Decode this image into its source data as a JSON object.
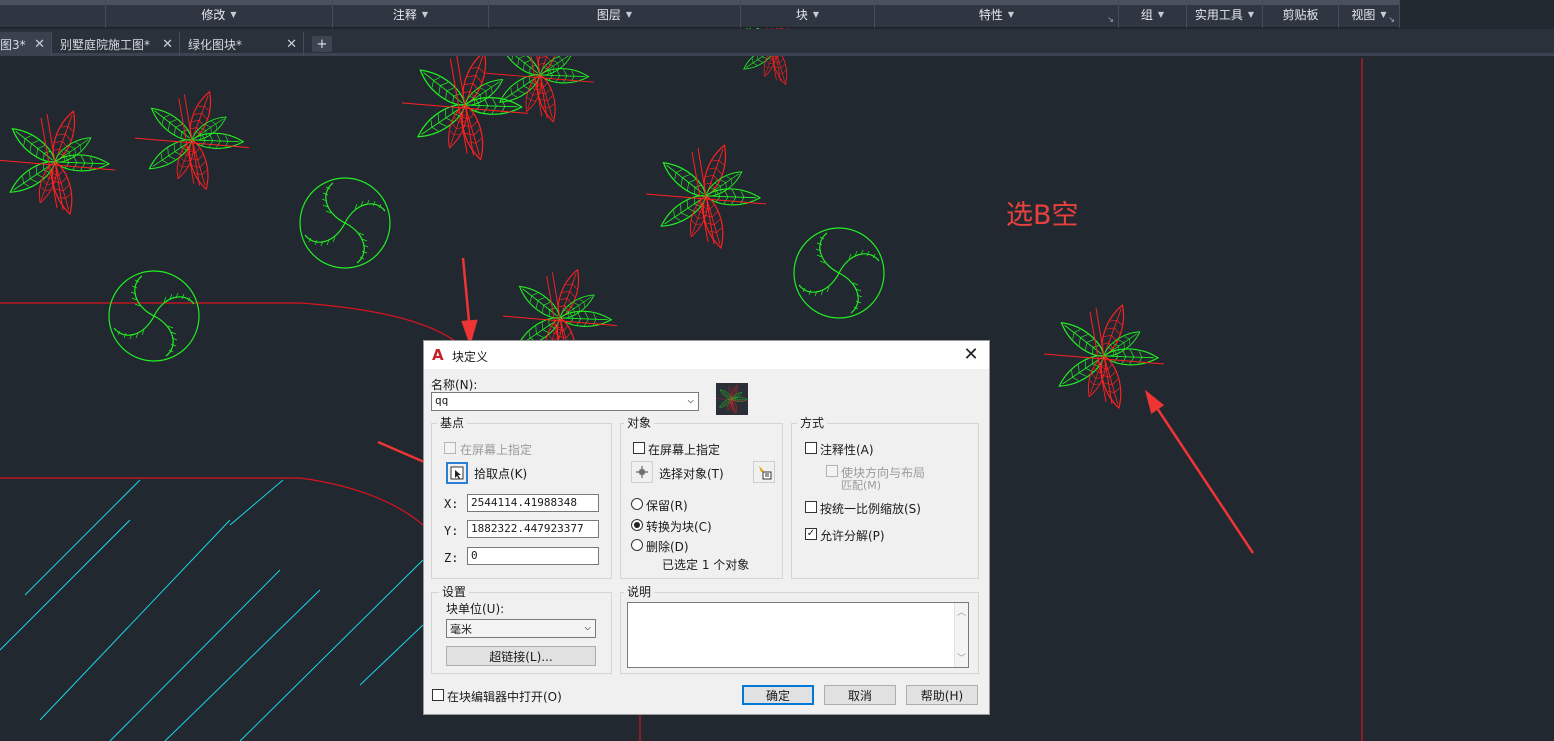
{
  "ribbon": {
    "panels": [
      {
        "label": "修改",
        "dropdown": true
      },
      {
        "label": "注释",
        "dropdown": true
      },
      {
        "label": "图层",
        "dropdown": true
      },
      {
        "label": "块",
        "dropdown": true
      },
      {
        "label": "特性",
        "dropdown": true,
        "launcher": true
      },
      {
        "label": "组",
        "dropdown": true
      },
      {
        "label": "实用工具",
        "dropdown": true
      },
      {
        "label": "剪贴板",
        "dropdown": false
      },
      {
        "label": "视图",
        "dropdown": true,
        "launcher": true
      }
    ]
  },
  "tabs": [
    {
      "label": "图3*",
      "active": true
    },
    {
      "label": "别墅庭院施工图*",
      "active": false
    },
    {
      "label": "绿化图块*",
      "active": false
    }
  ],
  "canvas": {
    "annotation": "选B空",
    "colors": {
      "background": "#212830",
      "plant_green": "#22ee22",
      "plant_red": "#ff2020",
      "boundary_red": "#d8141e",
      "hatch_cyan": "#18d6e8",
      "arrow_red": "#ee3434"
    }
  },
  "dialog": {
    "title": "块定义",
    "close_icon": "close-icon",
    "name_label": "名称(N):",
    "name_value": "qq",
    "basepoint": {
      "title": "基点",
      "specify_on_screen": "在屏幕上指定",
      "specify_on_screen_checked": false,
      "pick_point": "拾取点(K)",
      "x_label": "X:",
      "x_value": "2544114.41988348",
      "y_label": "Y:",
      "y_value": "1882322.447923377",
      "z_label": "Z:",
      "z_value": "0"
    },
    "objects": {
      "title": "对象",
      "specify_on_screen": "在屏幕上指定",
      "specify_on_screen_checked": false,
      "select_objects": "选择对象(T)",
      "retain": "保留(R)",
      "convert": "转换为块(C)",
      "delete": "删除(D)",
      "selected_option": "转换为块(C)",
      "status": "已选定 1 个对象"
    },
    "behavior": {
      "title": "方式",
      "annotative": "注释性(A)",
      "annotative_checked": false,
      "match_orientation_line1": "使块方向与布局",
      "match_orientation_line2": "匹配(M)",
      "match_orientation_checked": false,
      "scale_uniformly": "按统一比例缩放(S)",
      "scale_uniformly_checked": false,
      "allow_exploding": "允许分解(P)",
      "allow_exploding_checked": true
    },
    "settings": {
      "title": "设置",
      "block_unit_label": "块单位(U):",
      "block_unit_value": "毫米",
      "hyperlink_button": "超链接(L)..."
    },
    "description": {
      "title": "说明",
      "text": ""
    },
    "open_in_editor": "在块编辑器中打开(O)",
    "open_in_editor_checked": false,
    "ok_button": "确定",
    "cancel_button": "取消",
    "help_button": "帮助(H)"
  }
}
